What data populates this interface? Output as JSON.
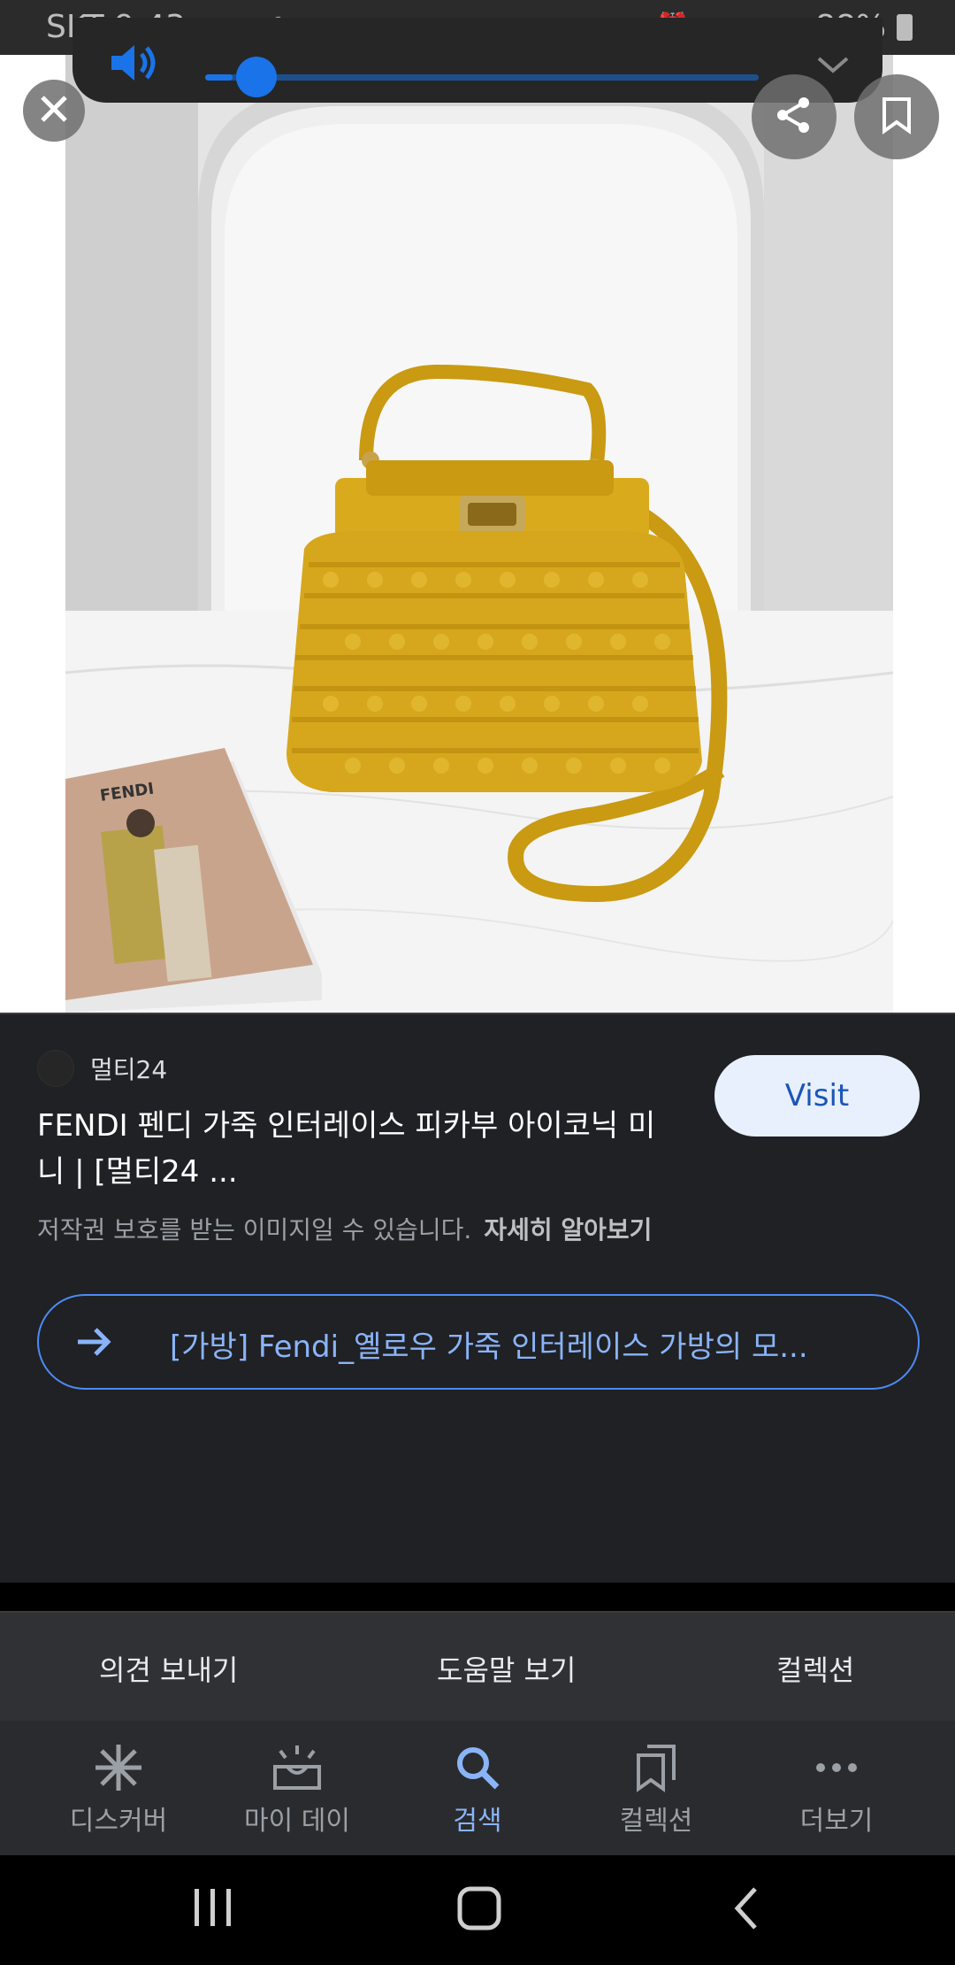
{
  "status_bar": {
    "carrier_time": "SKT 9:43",
    "battery": "88%",
    "icons": [
      "instagram-icon",
      "gallery-icon",
      "pen-icon",
      "dot-icon",
      "alarm-icon",
      "wifi-icon",
      "volte-icon",
      "signal-icon",
      "battery-icon"
    ]
  },
  "volume": {
    "icon": "speaker-icon",
    "level": 0.05,
    "expand_icon": "chevron-down-icon"
  },
  "image_viewer": {
    "close_icon": "close-icon",
    "share_icon": "share-icon",
    "bookmark_icon": "bookmark-icon",
    "magazine_brand": "FENDI"
  },
  "result": {
    "source_name": "멀티24",
    "title_line1": "FENDI 펜디 가죽 인터레이스 피카부 아이코닉 미",
    "title_line2": "니 | [멀티24 ...",
    "visit_label": "Visit",
    "copyright_text": "저작권 보호를 받는 이미지일 수 있습니다.",
    "learn_more": "자세히 알아보기",
    "related_label": "[가방] Fendi_옐로우 가죽 인터레이스 가방의 모..."
  },
  "footer_links": {
    "feedback": "의견 보내기",
    "help": "도움말 보기",
    "collections": "컬렉션"
  },
  "bottom_nav": [
    {
      "label": "디스커버",
      "icon": "discover-icon"
    },
    {
      "label": "마이 데이",
      "icon": "my-day-icon"
    },
    {
      "label": "검색",
      "icon": "search-icon",
      "active": true
    },
    {
      "label": "컬렉션",
      "icon": "collections-icon"
    },
    {
      "label": "더보기",
      "icon": "more-icon"
    }
  ],
  "colors": {
    "accent": "#8ab4f8",
    "visit_bg": "#e8f0fe",
    "bag_yellow": "#d8ac1c",
    "background": "#202124"
  }
}
